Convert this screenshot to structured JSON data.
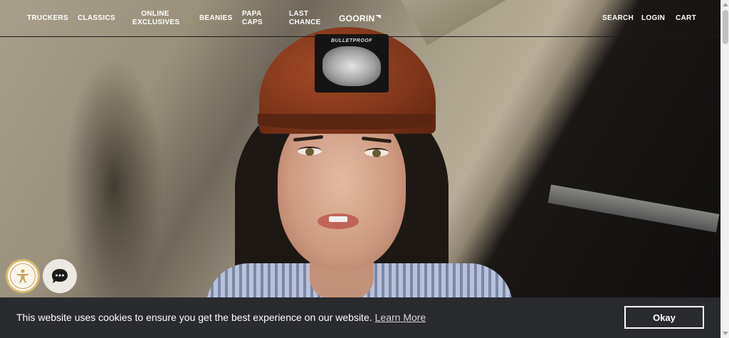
{
  "nav": {
    "items": [
      {
        "label": "TRUCKERS"
      },
      {
        "label": "CLASSICS"
      },
      {
        "label": "ONLINE EXCLUSIVES"
      },
      {
        "label": "BEANIES"
      },
      {
        "label": "PAPA CAPS"
      },
      {
        "label": "LAST CHANCE"
      }
    ],
    "logo": "GOORIN",
    "right": {
      "search": "SEARCH",
      "login": "LOGIN",
      "cart": "CART"
    }
  },
  "hero": {
    "patch_text": "BULLETPROOF"
  },
  "widgets": {
    "accessibility_icon": "accessibility-person-icon",
    "chat_icon": "chat-bubble-icon"
  },
  "cookie": {
    "message": "This website uses cookies to ensure you get the best experience on our website.",
    "link": "Learn More",
    "button": "Okay"
  },
  "colors": {
    "cookie_bg": "#2a2b2f",
    "accessibility_ring": "#d9b96f"
  }
}
